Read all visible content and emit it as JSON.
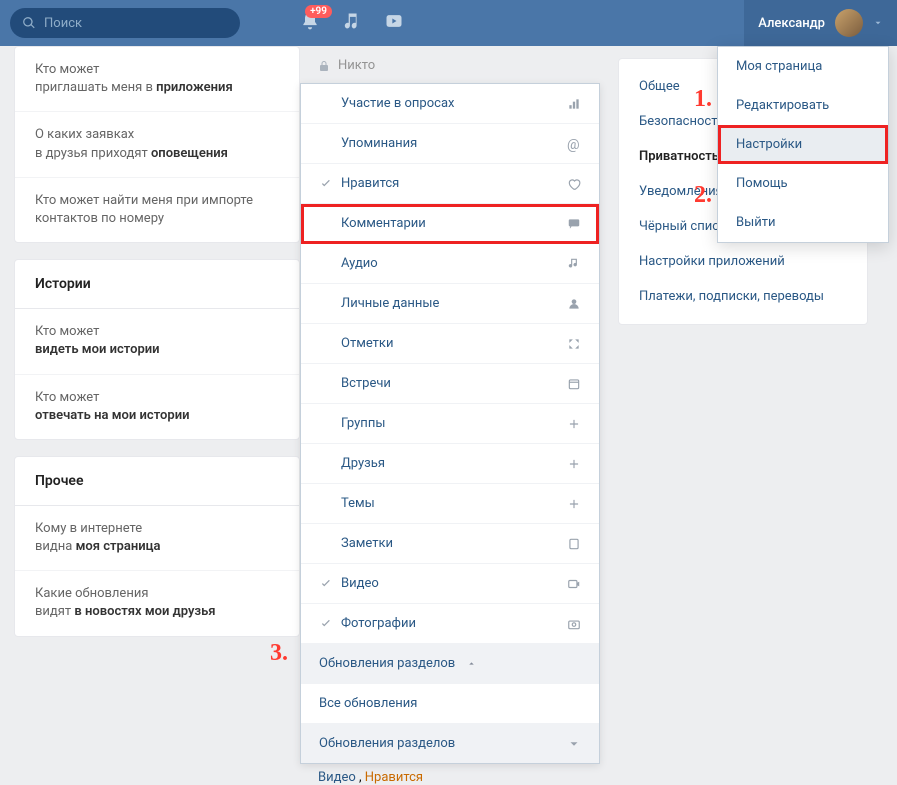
{
  "header": {
    "search_placeholder": "Поиск",
    "notification_badge": "+99",
    "user_name": "Александр"
  },
  "left": {
    "rows_top": [
      {
        "line1": "Кто может",
        "line2_pre": "приглашать меня в ",
        "line2_b": "приложения"
      },
      {
        "line1": "О каких заявках",
        "line2_pre": "в друзья приходят ",
        "line2_b": "оповещения"
      },
      {
        "line1": "Кто может найти меня при импорте",
        "line2_pre": "контактов по номеру",
        "line2_b": ""
      }
    ],
    "stories_header": "Истории",
    "stories_rows": [
      {
        "line1": "Кто может",
        "line2_pre": "",
        "line2_b": "видеть мои истории"
      },
      {
        "line1": "Кто может",
        "line2_pre": "",
        "line2_b": "отвечать на мои истории"
      }
    ],
    "other_header": "Прочее",
    "other_rows": [
      {
        "line1": "Кому в интернете",
        "line2_pre": "видна ",
        "line2_b": "моя страница"
      },
      {
        "line1": "Какие обновления",
        "line2_pre": "видят ",
        "line2_b": "в новостях мои друзья"
      }
    ]
  },
  "dropdown": {
    "top_label": "Никто",
    "items": [
      {
        "label": "Участие в опросах",
        "checked": false,
        "icon": "bars"
      },
      {
        "label": "Упоминания",
        "checked": false,
        "icon": "at"
      },
      {
        "label": "Нравится",
        "checked": true,
        "icon": "heart"
      },
      {
        "label": "Комментарии",
        "checked": false,
        "icon": "comment",
        "highlight": true
      },
      {
        "label": "Аудио",
        "checked": false,
        "icon": "music"
      },
      {
        "label": "Личные данные",
        "checked": false,
        "icon": "person"
      },
      {
        "label": "Отметки",
        "checked": false,
        "icon": "expand"
      },
      {
        "label": "Встречи",
        "checked": false,
        "icon": "calendar"
      },
      {
        "label": "Группы",
        "checked": false,
        "icon": "plus"
      },
      {
        "label": "Друзья",
        "checked": false,
        "icon": "plus"
      },
      {
        "label": "Темы",
        "checked": false,
        "icon": "plus"
      },
      {
        "label": "Заметки",
        "checked": false,
        "icon": "note"
      },
      {
        "label": "Видео",
        "checked": true,
        "icon": "video"
      },
      {
        "label": "Фотографии",
        "checked": true,
        "icon": "camera"
      }
    ],
    "section_header": "Обновления разделов",
    "all_updates": "Все обновления",
    "bottom_selected": "Обновления разделов",
    "tag_video": "Видео",
    "tag_like": "Нравится"
  },
  "right_menu": {
    "items": [
      {
        "label": "Общее",
        "active": false
      },
      {
        "label": "Безопасность",
        "active": false
      },
      {
        "label": "Приватность",
        "active": true
      },
      {
        "label": "Уведомления",
        "active": false
      },
      {
        "label": "Чёрный список",
        "active": false
      },
      {
        "label": "Настройки приложений",
        "active": false
      },
      {
        "label": "Платежи, подписки, переводы",
        "active": false
      }
    ]
  },
  "user_dropdown": {
    "items": [
      {
        "label": "Моя страница"
      },
      {
        "label": "Редактировать"
      },
      {
        "label": "Настройки",
        "highlight": true
      },
      {
        "label": "Помощь"
      },
      {
        "label": "Выйти"
      }
    ]
  },
  "annotations": {
    "n1": "1.",
    "n2": "2.",
    "n3": "3."
  }
}
